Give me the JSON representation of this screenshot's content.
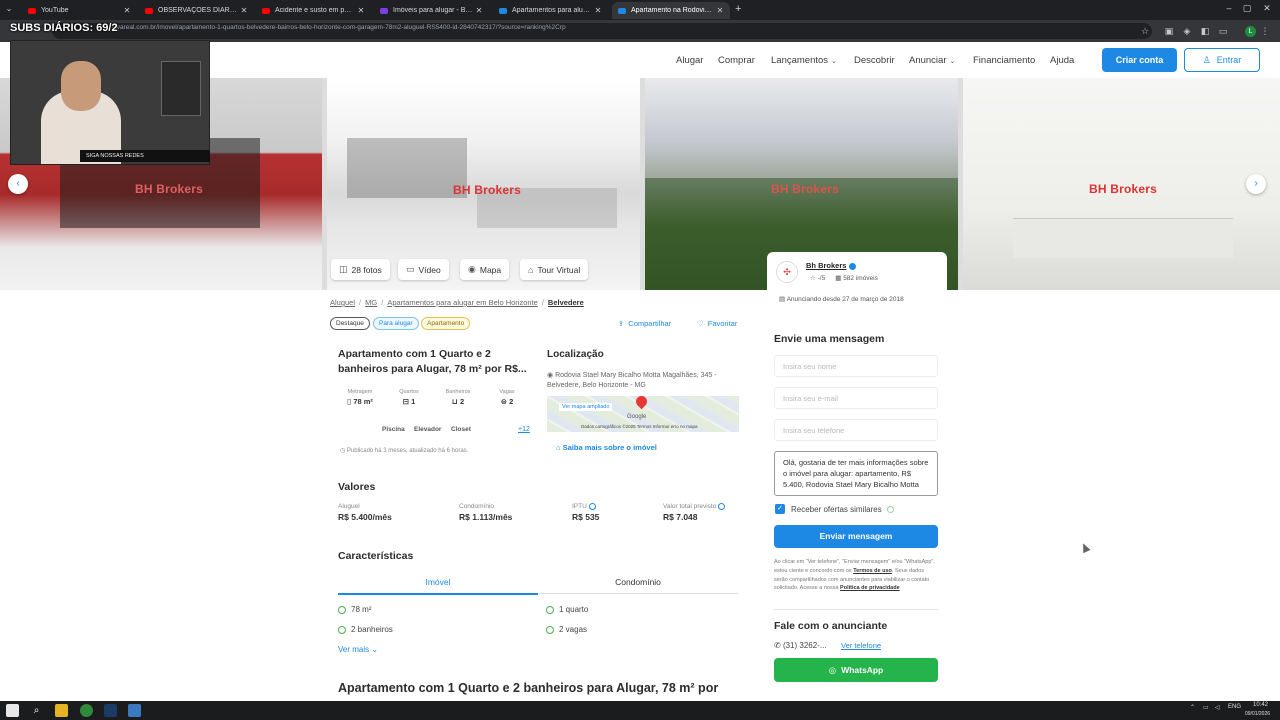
{
  "browser": {
    "tabs": [
      {
        "label": "YouTube",
        "color": "#ff0000"
      },
      {
        "label": "OBSERVAÇÕES DIÁRIAS (EP.30",
        "color": "#ff0000"
      },
      {
        "label": "Acidente e susto em posto na",
        "color": "#ff0000"
      },
      {
        "label": "Imóveis para alugar - Belo Hor",
        "color": "#7b3fe4"
      },
      {
        "label": "Apartamentos para alugar em",
        "color": "#1e88e5"
      },
      {
        "label": "Apartamento na Rodovia Stael",
        "color": "#1e88e5"
      }
    ],
    "url": "vivareal.com.br/imovel/apartamento-1-quartos-belvedere-bairros-belo-horizonte-com-garagem-78m2-aluguel-RS5400-id-2840742317/?source=ranking%2Crp"
  },
  "overlay": {
    "subs_counter": "SUBS DIÁRIOS: 69/2",
    "cam_label": "SIGA NOSSAS REDES"
  },
  "header": {
    "nav": [
      "Alugar",
      "Comprar",
      "Lançamentos",
      "Descobrir",
      "Anunciar",
      "Financiamento",
      "Ajuda"
    ],
    "criar_conta": "Criar conta",
    "entrar": "Entrar"
  },
  "gallery": {
    "watermark": "BH Brokers",
    "buttons": [
      {
        "label": "28 fotos",
        "icon": "camera-icon"
      },
      {
        "label": "Vídeo",
        "icon": "video-icon"
      },
      {
        "label": "Mapa",
        "icon": "map-pin-icon"
      },
      {
        "label": "Tour Virtual",
        "icon": "tour-icon"
      }
    ]
  },
  "breadcrumb": [
    "Aluguel",
    "MG",
    "Apartamentos para alugar em Belo Horizonte",
    "Belvedere"
  ],
  "tags": [
    "Destaque",
    "Para alugar",
    "Apartamento"
  ],
  "actions": {
    "share": "Compartilhar",
    "favorite": "Favoritar"
  },
  "listing": {
    "title": "Apartamento com 1 Quarto e 2 banheiros para Alugar, 78 m² por R$...",
    "stats": [
      {
        "label": "Metragem",
        "value": "78 m²"
      },
      {
        "label": "Quartos",
        "value": "1"
      },
      {
        "label": "Banheiros",
        "value": "2"
      },
      {
        "label": "Vagas",
        "value": "2"
      }
    ],
    "amenities": [
      "Piscina",
      "Elevador",
      "Closet"
    ],
    "amenities_more": "+12",
    "published": "Publicado há 3 meses, atualizado há 6 horas."
  },
  "location": {
    "title": "Localização",
    "address": "Rodovia Stael Mary Bicalho Motta Magalhães, 345 - Belvedere, Belo Horizonte - MG",
    "map_link": "Ver mapa ampliado",
    "map_google": "Google",
    "map_footer": "Dados cartográficos ©2026   Termos   Informar erro no mapa",
    "learn_more": "Saiba mais sobre o imóvel"
  },
  "valores": {
    "title": "Valores",
    "items": [
      {
        "label": "Aluguel",
        "value": "R$ 5.400/mês"
      },
      {
        "label": "Condomínio",
        "value": "R$ 1.113/mês"
      },
      {
        "label": "IPTU",
        "value": "R$ 535"
      },
      {
        "label": "Valor total previsto",
        "value": "R$ 7.048"
      }
    ]
  },
  "caracteristicas": {
    "title": "Características",
    "tabs": [
      "Imóvel",
      "Condomínio"
    ],
    "features": [
      "78 m²",
      "1 quarto",
      "2 banheiros",
      "2 vagas"
    ],
    "see_more": "Ver mais"
  },
  "bottom_title": "Apartamento com 1 Quarto e 2 banheiros para Alugar, 78 m² por",
  "broker": {
    "name": "Bh Brokers",
    "rating": "-/5",
    "listings": "582 imóveis",
    "since": "Anunciando desde 27 de março de 2018"
  },
  "message": {
    "title": "Envie uma mensagem",
    "name_placeholder": "Insira seu nome",
    "email_placeholder": "Insira seu e-mail",
    "phone_placeholder": "Insira seu telefone",
    "body": "Olá, gostaria de ter mais informações sobre o imóvel para alugar: apartamento, R$ 5.400, Rodovia Stael Mary Bicalho Motta",
    "similar_offers": "Receber ofertas similares",
    "send": "Enviar mensagem",
    "disclaimer": "Ao clicar em \"Ver telefone\", \"Enviar mensagem\" e/ou \"WhatsApp\", estou ciente e concordo com os",
    "terms": "Termos de uso",
    "disclaimer2": ". Seus dados serão compartilhados com anunciantes para viabilizar o contato solicitado. Acesse a nossa",
    "privacy": "Política de privacidade"
  },
  "contact": {
    "title": "Fale com o anunciante",
    "phone": "(31) 3262-...",
    "show_phone": "Ver telefone",
    "whatsapp": "WhatsApp"
  },
  "taskbar": {
    "lang": "ENG",
    "time": "10:42",
    "date": "09/01/2026"
  },
  "colors": {
    "accent": "#1e88e5",
    "whatsapp": "#25b34b",
    "brand_red": "#d33333"
  }
}
